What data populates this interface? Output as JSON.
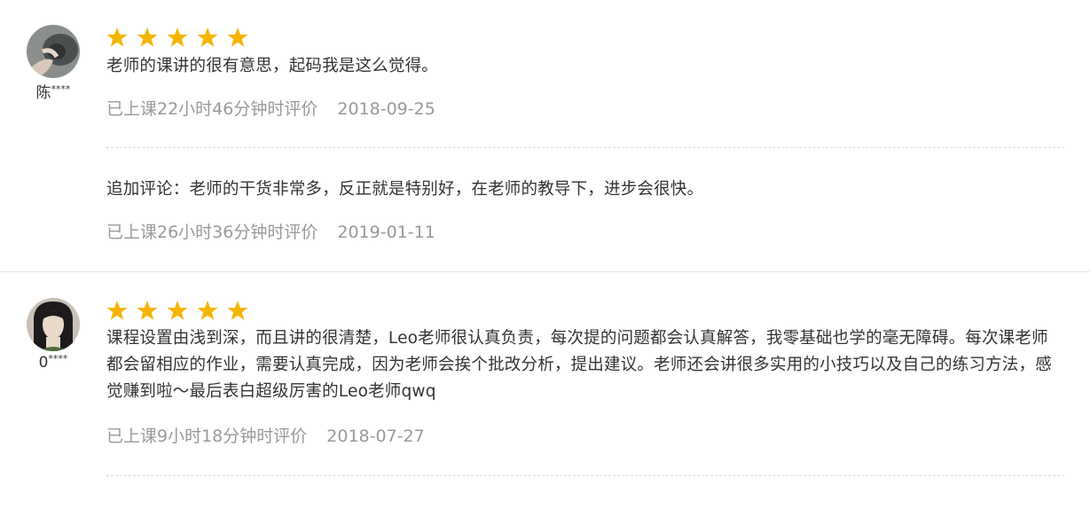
{
  "reviews": [
    {
      "username": "陈",
      "username_mask": "****",
      "rating": 5,
      "comment": "老师的课讲的很有意思，起码我是这么觉得。",
      "meta_label": "已上课22小时46分钟时评价",
      "date": "2018-09-25",
      "followup": {
        "comment": "追加评论：老师的干货非常多，反正就是特别好，在老师的教导下，进步会很快。",
        "meta_label": "已上课26小时36分钟时评价",
        "date": "2019-01-11"
      }
    },
    {
      "username": "0",
      "username_mask": "****",
      "rating": 5,
      "comment": "课程设置由浅到深，而且讲的很清楚，Leo老师很认真负责，每次提的问题都会认真解答，我零基础也学的毫无障碍。每次课老师都会留相应的作业，需要认真完成，因为老师会挨个批改分析，提出建议。老师还会讲很多实用的小技巧以及自己的练习方法，感觉赚到啦～最后表白超级厉害的Leo老师qwq",
      "meta_label": "已上课9小时18分钟时评价",
      "date": "2018-07-27"
    }
  ],
  "colors": {
    "star": "#f5b400",
    "text": "#333333",
    "meta": "#999999"
  }
}
